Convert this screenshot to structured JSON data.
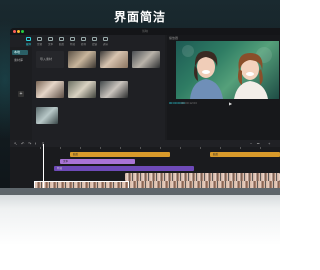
{
  "banner": {
    "headline": "界面简洁"
  },
  "window": {
    "title": "剪映"
  },
  "media": {
    "tabs": [
      {
        "label": "媒体",
        "icon": "media-icon",
        "active": true
      },
      {
        "label": "音频",
        "icon": "audio-icon"
      },
      {
        "label": "文本",
        "icon": "text-icon"
      },
      {
        "label": "贴纸",
        "icon": "sticker-icon"
      },
      {
        "label": "特效",
        "icon": "effects-icon"
      },
      {
        "label": "转场",
        "icon": "transition-icon"
      },
      {
        "label": "滤镜",
        "icon": "filter-icon"
      },
      {
        "label": "调节",
        "icon": "adjust-icon"
      }
    ],
    "sidebar": [
      {
        "label": "本地",
        "active": true
      },
      {
        "label": "素材库"
      }
    ],
    "import_label": "导入素材",
    "thumbs": [
      "",
      "",
      "",
      "",
      "",
      "",
      ""
    ]
  },
  "player": {
    "header": "播放器",
    "timecode": "00:00:00:00",
    "duration": "00:00:12:03"
  },
  "timeline": {
    "tracks": [
      {
        "label": "贴纸",
        "color": "#d89a2b"
      },
      {
        "label": "文本",
        "color": "#a974d6"
      },
      {
        "label": "特效",
        "color": "#6e4ab8"
      }
    ],
    "cover_label": "封面"
  },
  "colors": {
    "accent": "#2dd4e0",
    "sticker": "#d89a2b",
    "text": "#a974d6",
    "effect": "#6e4ab8"
  }
}
